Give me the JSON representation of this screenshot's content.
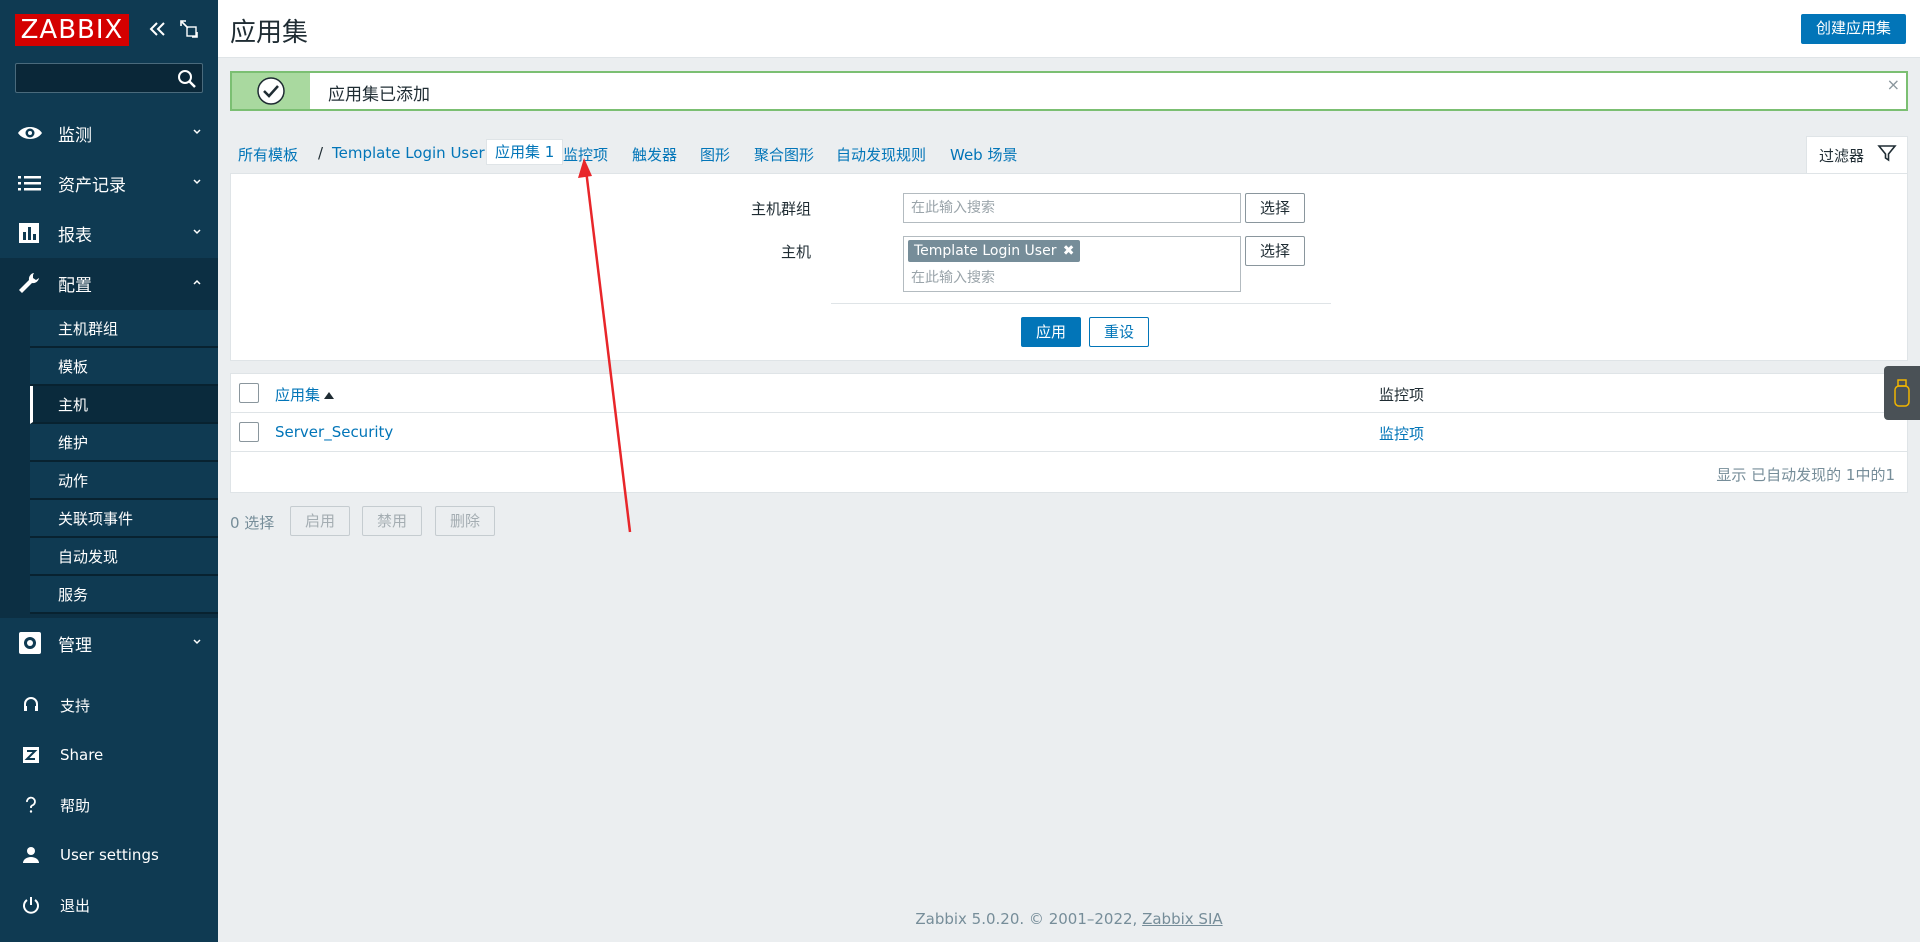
{
  "sidebar": {
    "logo_text": "ZABBIX",
    "search": {
      "value": "",
      "placeholder": ""
    },
    "menu": [
      {
        "label": "监测",
        "icon": "eye-icon"
      },
      {
        "label": "资产记录",
        "icon": "list-icon"
      },
      {
        "label": "报表",
        "icon": "bar-chart-icon"
      },
      {
        "label": "配置",
        "icon": "wrench-icon"
      }
    ],
    "config_submenu": [
      "主机群组",
      "模板",
      "主机",
      "维护",
      "动作",
      "关联项事件",
      "自动发现",
      "服务"
    ],
    "admin": {
      "label": "管理",
      "icon": "gear-icon"
    },
    "bottom": [
      {
        "label": "支持",
        "icon": "headset-icon"
      },
      {
        "label": "Share",
        "icon": "share-icon"
      },
      {
        "label": "帮助",
        "icon": "question-icon"
      },
      {
        "label": "User settings",
        "icon": "user-icon"
      },
      {
        "label": "退出",
        "icon": "power-icon"
      }
    ]
  },
  "header": {
    "title": "应用集",
    "create_button": "创建应用集"
  },
  "message": {
    "text": "应用集已添加"
  },
  "tabs": {
    "crumbs": [
      "所有模板",
      "Template Login User"
    ],
    "separator": "/",
    "active": "应用集 1",
    "links": [
      "监控项",
      "触发器",
      "图形",
      "聚合图形",
      "自动发现规则",
      "Web 场景"
    ],
    "filter_label": "过滤器"
  },
  "filter": {
    "host_group_label": "主机群组",
    "host_group_placeholder": "在此输入搜索",
    "host_label": "主机",
    "host_tag": "Template Login User",
    "host_placeholder": "在此输入搜索",
    "select_button": "选择",
    "apply_button": "应用",
    "reset_button": "重设"
  },
  "table": {
    "headers": {
      "application": "应用集",
      "items": "监控项"
    },
    "rows": [
      {
        "application": "Server_Security",
        "items": "监控项"
      }
    ],
    "footer": "显示 已自动发现的 1中的1"
  },
  "bulk": {
    "count": "0 选择",
    "buttons": [
      "启用",
      "禁用",
      "删除"
    ]
  },
  "footer": {
    "text": "Zabbix 5.0.20. © 2001–2022, ",
    "link": "Zabbix SIA"
  },
  "colors": {
    "sidebar": "#0f3a52",
    "accent": "#0275b8",
    "success": "#7bbf72",
    "logo": "#d40000"
  }
}
